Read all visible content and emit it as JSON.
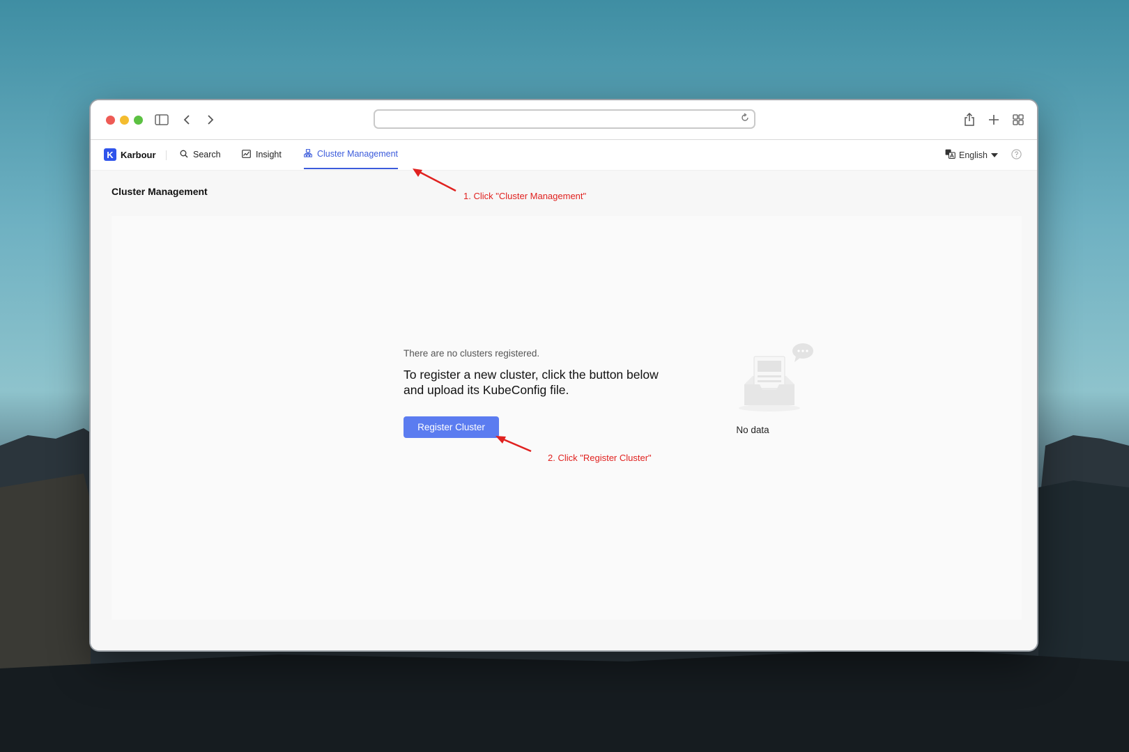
{
  "browser": {
    "address_value": ""
  },
  "app": {
    "brand_initial": "K",
    "brand_name": "Karbour",
    "nav": [
      {
        "label": "Search",
        "icon": "search-icon"
      },
      {
        "label": "Insight",
        "icon": "chart-icon"
      },
      {
        "label": "Cluster Management",
        "icon": "cluster-icon",
        "active": true
      }
    ],
    "language": "English",
    "accent_color": "#3b5bdb"
  },
  "page": {
    "title": "Cluster Management",
    "empty_subtitle": "There are no clusters registered.",
    "empty_message": "To register a new cluster, click the button below and upload its KubeConfig file.",
    "register_button": "Register Cluster",
    "no_data": "No data"
  },
  "annotations": {
    "step1": "1. Click \"Cluster Management\"",
    "step2": "2. Click \"Register Cluster\"",
    "color": "#e0211f"
  }
}
